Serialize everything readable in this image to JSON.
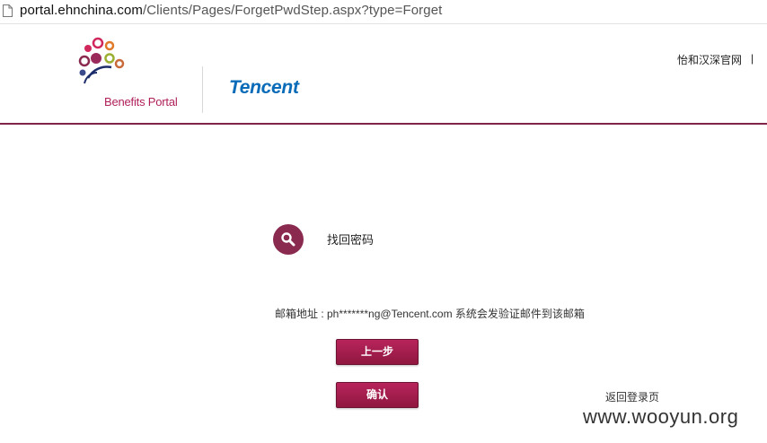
{
  "browser": {
    "url_domain": "portal.ehnchina.com",
    "url_path": "/Clients/Pages/ForgetPwdStep.aspx?type=Forget"
  },
  "header": {
    "logo_caption": "Benefits Portal",
    "partner_logo_text": "Tencent",
    "top_link": "怡和汉深官网",
    "top_separator": "|"
  },
  "main": {
    "section_title": "找回密码",
    "email_line": "邮箱地址 : ph*******ng@Tencent.com 系统会发验证邮件到该邮箱",
    "prev_button_label": "上一步",
    "confirm_button_label": "确认",
    "back_to_login_label": "返回登录页"
  },
  "watermark": "www.wooyun.org",
  "colors": {
    "brand_maroon": "#8a2a4f",
    "header_rule": "#7e2448",
    "tencent_blue": "#0a6cb8",
    "button_top": "#b8245a",
    "button_bottom": "#8f1740"
  },
  "icons": {
    "page": "page-icon",
    "search": "search-icon",
    "logo": "benefits-portal-logo-icon"
  }
}
